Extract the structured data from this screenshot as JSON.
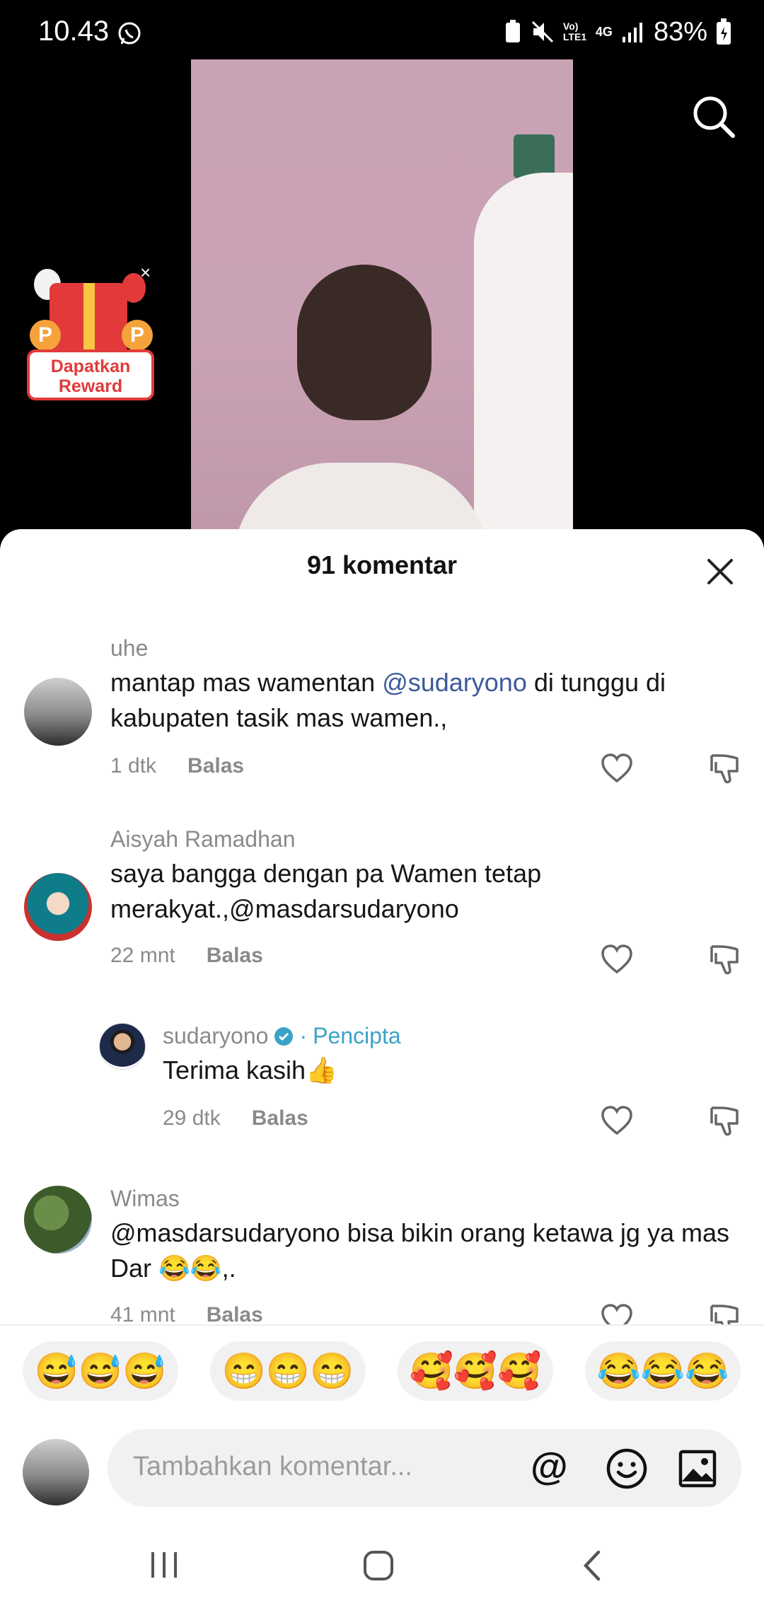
{
  "status_bar": {
    "time": "10.43",
    "network_lte": "Vo) LTE1",
    "network_4g": "4G",
    "battery": "83%"
  },
  "reward": {
    "line1": "Dapatkan",
    "line2": "Reward",
    "close": "×"
  },
  "sheet": {
    "title": "91 komentar"
  },
  "comments": [
    {
      "user": "uhe",
      "text_before": "mantap mas wamentan ",
      "mention": "@sudaryono",
      "text_after": " di tunggu di kabupaten tasik mas wamen.,",
      "time": "1 dtk",
      "reply": "Balas"
    },
    {
      "user": "Aisyah Ramadhan",
      "text": "saya bangga dengan pa Wamen tetap merakyat.,@masdarsudaryono",
      "time": "22 mnt",
      "reply": "Balas"
    },
    {
      "user": "sudaryono",
      "creator_sep": "·",
      "creator_label": "Pencipta",
      "text": "Terima kasih👍",
      "time": "29 dtk",
      "reply": "Balas"
    },
    {
      "user": "Wimas",
      "text": "@masdarsudaryono bisa bikin orang ketawa jg ya mas Dar 😂😂,.",
      "time": "41 mnt",
      "reply": "Balas"
    }
  ],
  "emoji_bar": [
    "😅😅😅",
    "😁😁😁",
    "🥰🥰🥰",
    "😂😂😂"
  ],
  "input": {
    "placeholder": "Tambahkan komentar...",
    "at": "@"
  },
  "colors": {
    "accent_creator": "#3ba3c8",
    "mention": "#3d5a9a",
    "reward_red": "#e23a3a"
  }
}
